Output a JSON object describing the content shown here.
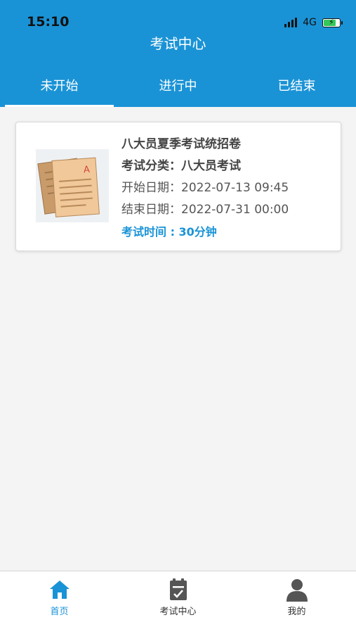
{
  "status_bar": {
    "time": "15:10",
    "network": "4G"
  },
  "header": {
    "title": "考试中心"
  },
  "tabs": [
    {
      "label": "未开始",
      "active": true
    },
    {
      "label": "进行中",
      "active": false
    },
    {
      "label": "已结束",
      "active": false
    }
  ],
  "exam_card": {
    "title": "八大员夏季考试统招卷",
    "category": "考试分类：八大员考试",
    "start": "开始日期：2022-07-13 09:45",
    "end": "结束日期：2022-07-31 00:00",
    "duration": "考试时间 : 30分钟"
  },
  "bottom_nav": [
    {
      "label": "首页",
      "icon": "home-icon",
      "active": true
    },
    {
      "label": "考试中心",
      "icon": "clipboard-icon",
      "active": false
    },
    {
      "label": "我的",
      "icon": "user-icon",
      "active": false
    }
  ],
  "colors": {
    "primary": "#1a93d6",
    "background": "#f4f4f4"
  }
}
